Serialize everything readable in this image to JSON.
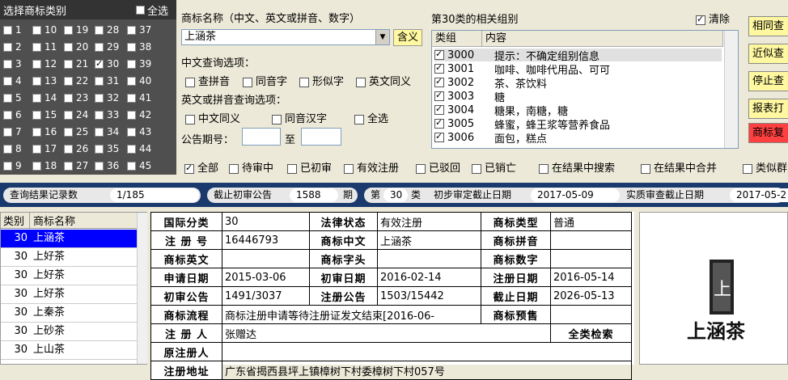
{
  "category_panel": {
    "title": "选择商标类别",
    "select_all": "全选",
    "columns": [
      [
        "1",
        "2",
        "3",
        "4",
        "5",
        "6",
        "7",
        "8",
        "9"
      ],
      [
        "10",
        "11",
        "12",
        "13",
        "14",
        "15",
        "16",
        "17",
        "18"
      ],
      [
        "19",
        "20",
        "21",
        "22",
        "23",
        "24",
        "25",
        "26",
        "27"
      ],
      [
        "28",
        "29",
        "30",
        "31",
        "32",
        "33",
        "34",
        "35",
        "36"
      ],
      [
        "37",
        "38",
        "39",
        "40",
        "41",
        "42",
        "43",
        "44",
        "45"
      ]
    ],
    "checked": [
      "30"
    ]
  },
  "search": {
    "name_label": "商标名称（中文、英文或拼音、数字）",
    "name_value": "上涵茶",
    "meaning_button": "含义",
    "cn_options_label": "中文查询选项：",
    "cn_options": [
      "查拼音",
      "同音字",
      "形似字",
      "英文同义"
    ],
    "en_options_label": "英文或拼音查询选项：",
    "en_options": [
      "中文同义",
      "同音汉字",
      "全选"
    ],
    "gazette_label": "公告期号：",
    "gazette_to": "至"
  },
  "groups": {
    "title": "第30类的相关组别",
    "clear": "清除",
    "header_group": "类组",
    "header_content": "内容",
    "rows": [
      {
        "code": "3000",
        "text": "提示：不确定组别信息"
      },
      {
        "code": "3001",
        "text": "咖啡、咖啡代用品、可可"
      },
      {
        "code": "3002",
        "text": "茶、茶饮料"
      },
      {
        "code": "3003",
        "text": "糖"
      },
      {
        "code": "3004",
        "text": "糖果，南糖，糖"
      },
      {
        "code": "3005",
        "text": "蜂蜜，蜂王浆等营养食品"
      },
      {
        "code": "3006",
        "text": "面包，糕点"
      }
    ]
  },
  "right_buttons": [
    "相同查",
    "近似查",
    "停止查",
    "报表打",
    "商标复"
  ],
  "filters": [
    "全部",
    "待审中",
    "已初审",
    "有效注册",
    "已驳回",
    "已销亡",
    "在结果中搜索",
    "在结果中合并",
    "类似群"
  ],
  "status_bar": {
    "records_label": "查询结果记录数",
    "records_value": "1/185",
    "deadline_label": "截止初审公告",
    "deadline_value": "1588",
    "deadline_unit": "期",
    "class_prefix": "第",
    "class_value": "30",
    "class_suffix": "类",
    "initial_label": "初步审定截止日期",
    "initial_value": "2017-05-09",
    "exam_label": "实质审查截止日期",
    "exam_value": "2017-05-2"
  },
  "result_list": {
    "header_class": "类别",
    "header_name": "商标名称",
    "rows": [
      {
        "cls": "30",
        "name": "上涵茶"
      },
      {
        "cls": "30",
        "name": "上好茶"
      },
      {
        "cls": "30",
        "name": "上好茶"
      },
      {
        "cls": "30",
        "name": "上好茶"
      },
      {
        "cls": "30",
        "name": "上秦茶"
      },
      {
        "cls": "30",
        "name": "上砂茶"
      },
      {
        "cls": "30",
        "name": "上山茶"
      }
    ]
  },
  "detail": {
    "intl_class_label": "国际分类",
    "intl_class": "30",
    "legal_status_label": "法律状态",
    "legal_status": "有效注册",
    "type_label": "商标类型",
    "type": "普通",
    "reg_no_label": "注 册 号",
    "reg_no": "16446793",
    "cn_label": "商标中文",
    "cn": "上涵茶",
    "pinyin_label": "商标拼音",
    "pinyin": "",
    "en_label": "商标英文",
    "en": "",
    "head_label": "商标字头",
    "head": "",
    "digits_label": "商标数字",
    "digits": "",
    "apply_date_label": "申请日期",
    "apply_date": "2015-03-06",
    "initial_date_label": "初审日期",
    "initial_date": "2016-02-14",
    "reg_date_label": "注册日期",
    "reg_date": "2016-05-14",
    "initial_pub_label": "初审公告",
    "initial_pub": "1491/3037",
    "reg_pub_label": "注册公告",
    "reg_pub": "1503/15442",
    "expire_label": "截止日期",
    "expire": "2026-05-13",
    "flow_label": "商标流程",
    "flow": "商标注册申请等待注册证发文结束[2016-06-",
    "warn_label": "商标预售",
    "warn": "",
    "registrant_label": "注 册 人",
    "registrant": "张赠达",
    "full_search": "全类检索",
    "orig_label": "原注册人",
    "orig": "",
    "address_label": "注册地址",
    "address": "广东省揭西县坪上镇樟树下村委樟树下村057号"
  },
  "logo": {
    "text": "上涵茶"
  }
}
